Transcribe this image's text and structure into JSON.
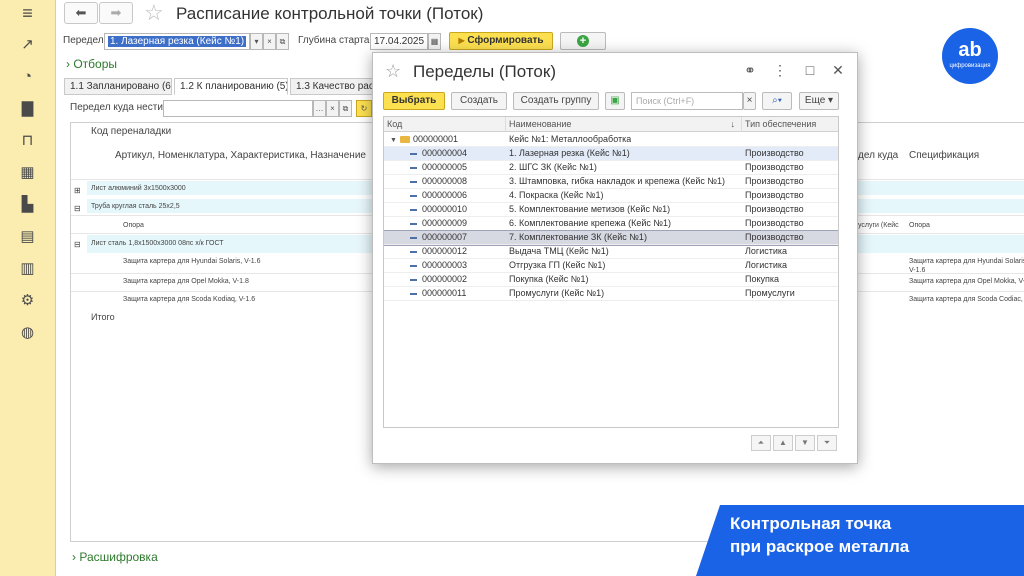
{
  "window": {
    "title": "Расписание контрольной точки (Поток)"
  },
  "filters": {
    "peredel_label": "Передел:",
    "peredel_value": "1. Лазерная резка (Кейс №1)",
    "depth_label": "Глубина старта:",
    "depth_value": "17.04.2025",
    "form_button": "Сформировать",
    "otbory_label": "Отборы",
    "rasshifrovka_label": "Расшифровка"
  },
  "tabs": [
    {
      "label": "1.1 Запланировано (6)"
    },
    {
      "label": "1.2 К планированию (5)"
    },
    {
      "label": "1.3 Качество рас"
    }
  ],
  "background_form": {
    "dest_label": "Передел куда нести:",
    "col_code": "Код переналадки",
    "col_article": "Артикул, Номенклатура, Характеристика, Назначение",
    "col_dest_partial": "дел куда",
    "col_spec": "Спецификация",
    "rows": [
      {
        "text": "Лист алюминий 3х1500х3000"
      },
      {
        "text": "Труба круглая сталь 25х2,5"
      },
      {
        "text": "Опора",
        "dest": "услуги (Кейс",
        "spec": "Опора"
      },
      {
        "text": "Лист сталь 1,8х1500х3000 08пс х/к ГОСТ"
      },
      {
        "text": "Защита картера для Hyundai Solaris, V-1.6",
        "spec": "Защита картера для Hyundai Solaris,",
        "spec2": "V-1.6"
      },
      {
        "text": "Защита картера для Opel Mokka, V-1.8",
        "spec": "Защита картера для Opel Mokka, V-"
      },
      {
        "text": "Защита картера для Scoda Kodiaq, V-1.6",
        "spec": "Защита картера для Scoda Codiac, V"
      }
    ],
    "total_label": "Итого"
  },
  "dialog": {
    "title": "Переделы (Поток)",
    "buttons": {
      "select": "Выбрать",
      "create": "Создать",
      "create_group": "Создать группу",
      "more": "Еще"
    },
    "search_placeholder": "Поиск (Ctrl+F)",
    "columns": {
      "code": "Код",
      "name": "Наименование",
      "supply": "Тип обеспечения"
    },
    "group_row": {
      "code": "000000001",
      "name": "Кейс №1: Металлообработка"
    },
    "rows": [
      {
        "code": "000000004",
        "name": "1. Лазерная резка (Кейс №1)",
        "supply": "Производство"
      },
      {
        "code": "000000005",
        "name": "2. ШГС ЗК (Кейс №1)",
        "supply": "Производство"
      },
      {
        "code": "000000008",
        "name": "3. Штамповка, гибка накладок и крепежа (Кейс №1)",
        "supply": "Производство"
      },
      {
        "code": "000000006",
        "name": "4. Покраска (Кейс №1)",
        "supply": "Производство"
      },
      {
        "code": "000000010",
        "name": "5. Комплектование метизов (Кейс №1)",
        "supply": "Производство"
      },
      {
        "code": "000000009",
        "name": "6. Комплектование крепежа (Кейс №1)",
        "supply": "Производство"
      },
      {
        "code": "000000007",
        "name": "7. Комплектование ЗК (Кейс №1)",
        "supply": "Производство"
      },
      {
        "code": "000000012",
        "name": "Выдача ТМЦ (Кейс №1)",
        "supply": "Логистика"
      },
      {
        "code": "000000003",
        "name": "Отгрузка ГП (Кейс №1)",
        "supply": "Логистика"
      },
      {
        "code": "000000002",
        "name": "Покупка (Кейс №1)",
        "supply": "Покупка"
      },
      {
        "code": "000000011",
        "name": "Промуслуги (Кейс №1)",
        "supply": "Промуслуги"
      }
    ]
  },
  "logo": {
    "glyph": "ab",
    "text": "цифровизация"
  },
  "banner": {
    "line1": "Контрольная точка",
    "line2": "при раскрое металла"
  },
  "colors": {
    "sidebar": "#fbecb0",
    "accent_yellow": "#fce050",
    "banner_blue": "#1b63e6",
    "green_link": "#2d7a2d"
  }
}
